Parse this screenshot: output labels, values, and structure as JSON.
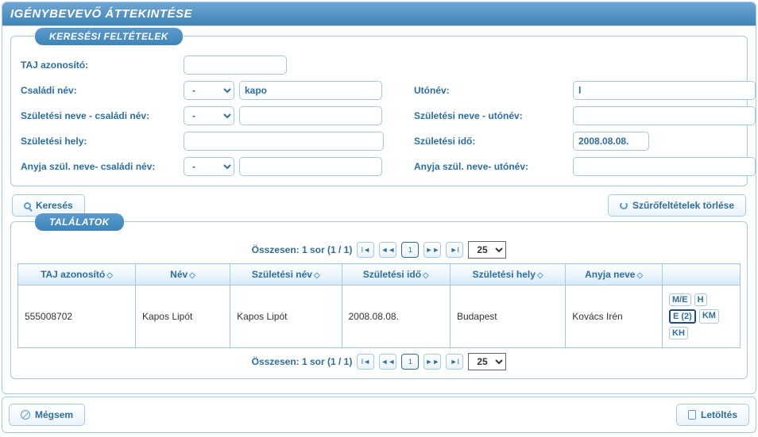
{
  "title": "Igénybevevő áttekintése",
  "fs1": {
    "legend": "Keresési feltételek"
  },
  "labels": {
    "taj": "TAJ azonosító:",
    "csn": "Családi név:",
    "uton": "Utónév:",
    "birth_csn": "Születési neve - családi név:",
    "birth_uton": "Születési neve - utónév:",
    "birth_place": "Születési hely:",
    "birth_date": "Születési idő:",
    "mother_csn": "Anyja szül. neve- családi név:",
    "mother_uton": "Anyja szül. neve- utónév:"
  },
  "operators": {
    "selected": "-"
  },
  "values": {
    "taj": "",
    "csn": "kapo",
    "uton": "l",
    "birth_csn": "",
    "birth_uton": "",
    "birth_place": "",
    "birth_date": "2008.08.08.",
    "mother_csn": "",
    "mother_uton": ""
  },
  "buttons": {
    "search": "Keresés",
    "clear": "Szűrőfeltételek törlése",
    "cancel": "Mégsem",
    "download": "Letöltés"
  },
  "fs2": {
    "legend": "Találatok"
  },
  "paginator": {
    "summary": "Összesen: 1 sor (1 / 1)",
    "page": "1",
    "per_page": "25"
  },
  "columns": {
    "c1": "TAJ azonosító",
    "c2": "Név",
    "c3": "Születési név",
    "c4": "Születési idő",
    "c5": "Születési hely",
    "c6": "Anyja neve"
  },
  "rows": [
    {
      "taj": "555008702",
      "nev": "Kapos Lipót",
      "sznev": "Kapos Lipót",
      "szido": "2008.08.08.",
      "szhely": "Budapest",
      "anyja": "Kovács Irén",
      "actions": [
        {
          "l": "M/E"
        },
        {
          "l": "H"
        },
        {
          "l": "E (2)",
          "on": true
        },
        {
          "l": "KM"
        },
        {
          "l": "KH"
        }
      ]
    }
  ]
}
